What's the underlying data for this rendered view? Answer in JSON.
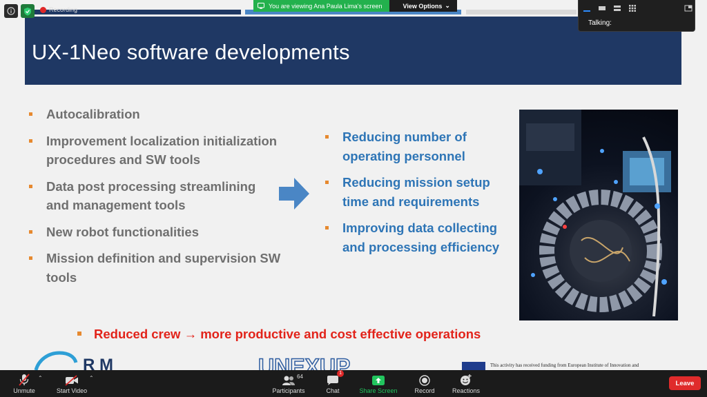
{
  "meeting": {
    "recording_label": "Recording",
    "viewing_text": "You are viewing Ana Paula Lima's screen",
    "view_options_label": "View Options",
    "talking_label": "Talking:"
  },
  "slide": {
    "title": "UX-1Neo software developments",
    "left_bullets": [
      "Autocalibration",
      "Improvement  localization initialization procedures and SW tools",
      "Data post processing streamlining and management tools",
      "New robot functionalities",
      "Mission definition and supervision SW tools"
    ],
    "right_bullets": [
      "Reducing number of operating personnel",
      "Reducing mission setup time and requirements",
      "Improving data collecting and processing efficiency"
    ],
    "conclusion": "Reduced crew → more productive and cost effective operations",
    "funding_text": "This activity has received funding from European Institute of Innovation and",
    "colors": {
      "header_bg": "#1f3864",
      "left_text": "#6f6f6f",
      "right_text": "#2e75b6",
      "bullet_marker": "#e6892f",
      "conclusion_text": "#e2231a"
    }
  },
  "toolbar": {
    "unmute_label": "Unmute",
    "start_video_label": "Start Video",
    "participants_label": "Participants",
    "participants_count": "64",
    "chat_label": "Chat",
    "chat_badge": "1",
    "share_screen_label": "Share Screen",
    "record_label": "Record",
    "reactions_label": "Reactions",
    "leave_label": "Leave",
    "colors": {
      "leave_bg": "#e02b2b",
      "share_green": "#22c55e"
    }
  }
}
